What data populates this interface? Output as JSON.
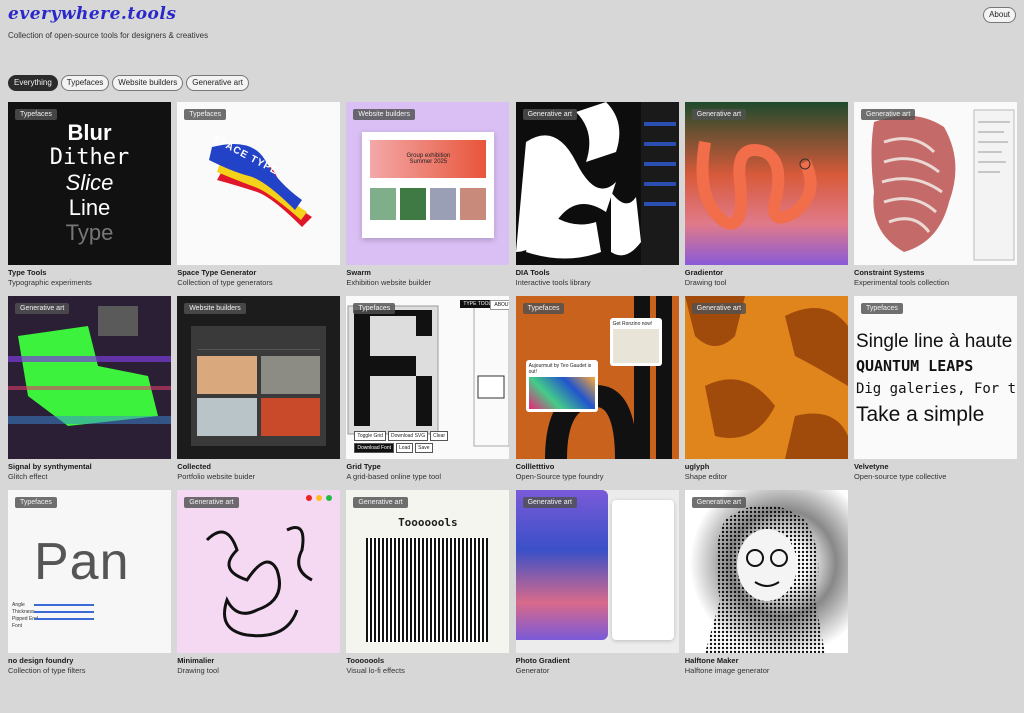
{
  "header": {
    "logo": "everywhere.tools",
    "tagline": "Collection of open-source tools for designers & creatives",
    "about_label": "About"
  },
  "filters": [
    "Everything",
    "Typefaces",
    "Website builders",
    "Generative art"
  ],
  "active_filter": "Everything",
  "cards": [
    {
      "tag": "Typefaces",
      "title": "Type Tools",
      "desc": "Typographic experiments"
    },
    {
      "tag": "Typefaces",
      "title": "Space Type Generator",
      "desc": "Collection of type generators"
    },
    {
      "tag": "Website builders",
      "title": "Swarm",
      "desc": "Exhibition website builder"
    },
    {
      "tag": "Generative art",
      "title": "DIA Tools",
      "desc": "Interactive tools library"
    },
    {
      "tag": "Generative art",
      "title": "Gradientor",
      "desc": "Drawing tool"
    },
    {
      "tag": "Generative art",
      "title": "Constraint Systems",
      "desc": "Experimental tools collection"
    },
    {
      "tag": "Generative art",
      "title": "Signal by synthymental",
      "desc": "Glitch effect"
    },
    {
      "tag": "Website builders",
      "title": "Collected",
      "desc": "Portfolio website buider"
    },
    {
      "tag": "Typefaces",
      "title": "Grid Type",
      "desc": "A grid-based online type tool"
    },
    {
      "tag": "Typefaces",
      "title": "Collletttivo",
      "desc": "Open-Source type foundry"
    },
    {
      "tag": "Generative art",
      "title": "uglyph",
      "desc": "Shape editor"
    },
    {
      "tag": "Typefaces",
      "title": "Velvetyne",
      "desc": "Open-source type collective"
    },
    {
      "tag": "Typefaces",
      "title": "no design foundry",
      "desc": "Collection of type filters"
    },
    {
      "tag": "Generative art",
      "title": "Minimalier",
      "desc": "Drawing tool"
    },
    {
      "tag": "Generative art",
      "title": "Tooooools",
      "desc": "Visual lo-fi effects"
    },
    {
      "tag": "Generative art",
      "title": "Photo Gradient",
      "desc": "Generator"
    },
    {
      "tag": "Generative art",
      "title": "Halftone Maker",
      "desc": "Halftone image generator"
    }
  ],
  "thumb_text": {
    "type_tools": [
      "Blur",
      "Dither",
      "Slice",
      "Line",
      "Type"
    ],
    "space_type": "SPACE TYPE",
    "swarm_heading": "Group exhibition Summer 2025",
    "grid_type_btns": [
      "Toggle Grid",
      "Download SVG",
      "Clear",
      "Download Font",
      "Load",
      "Save"
    ],
    "grid_type_tabs": [
      "TYPE TOOL",
      "ABOUT"
    ],
    "colletttivo_a": "Aujourmuit by Teo Gaudet is out!",
    "colletttivo_b": "Get Ronzino now!",
    "velvetyne_lines": [
      "Single line à haute",
      "QUANTUM LEAPS",
      "Dig galeries, For the",
      "Take a simple"
    ],
    "nodesign_word": "Pan",
    "tooooools_word": "Tooooools",
    "nodesign_sliders": [
      "Angle",
      "Thickness",
      "Pipped End",
      "Font"
    ]
  }
}
